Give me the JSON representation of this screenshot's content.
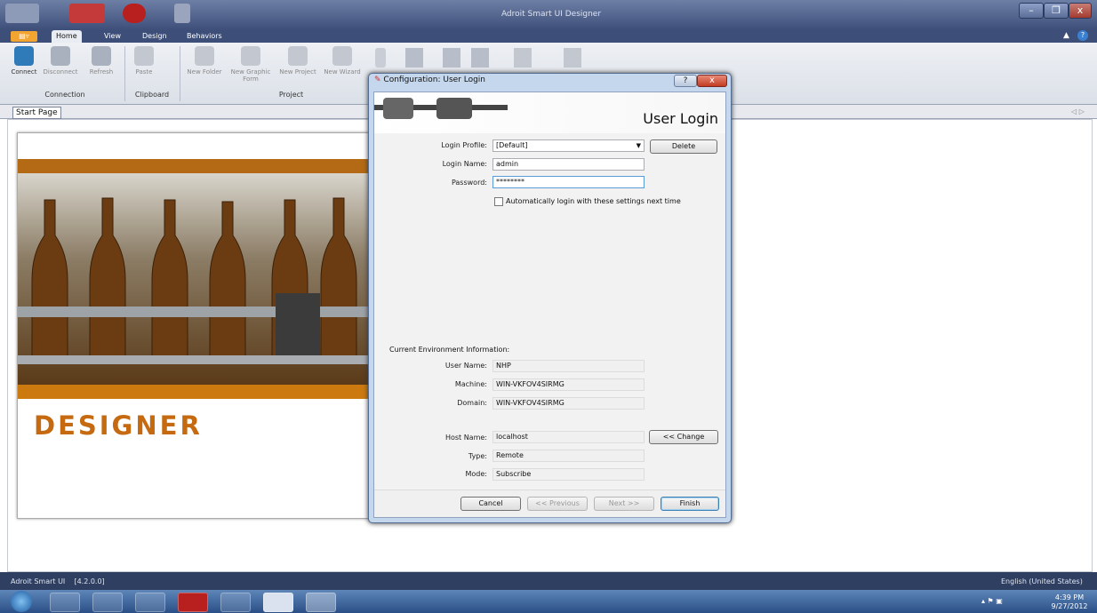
{
  "app": {
    "title": "Adroit Smart UI Designer",
    "tabs": [
      "Home",
      "View",
      "Design",
      "Behaviors"
    ],
    "window_controls": {
      "minimize": "–",
      "maximize": "❐",
      "close": "x"
    }
  },
  "ribbon": {
    "buttons": [
      {
        "label": "Connect",
        "icon": "connect-icon"
      },
      {
        "label": "Disconnect",
        "icon": "disconnect-icon"
      },
      {
        "label": "Refresh",
        "icon": "refresh-icon"
      },
      {
        "label": "Paste",
        "icon": "paste-icon"
      },
      {
        "label": "New Folder",
        "icon": "new-folder-icon"
      },
      {
        "label": "New Graphic Form",
        "icon": "new-graphic-form-icon"
      },
      {
        "label": "New Project",
        "icon": "new-project-icon"
      },
      {
        "label": "New Wizard",
        "icon": "new-wizard-icon"
      }
    ],
    "groups": [
      "Connection",
      "Clipboard",
      "Project"
    ]
  },
  "document_tab": "Start Page",
  "start_page": {
    "banner_text": "DESIGNER"
  },
  "dialog": {
    "title": "Configuration: User Login",
    "heading": "User Login",
    "login_profile_label": "Login Profile:",
    "login_profile_value": "[Default]",
    "delete_label": "Delete",
    "login_name_label": "Login Name:",
    "login_name_value": "admin",
    "password_label": "Password:",
    "password_value": "********",
    "auto_login_label": "Automatically login with these settings next time",
    "env_section_label": "Current Environment Information:",
    "user_name_label": "User Name:",
    "user_name_value": "NHP",
    "machine_label": "Machine:",
    "machine_value": "WIN-VKFOV4SIRMG",
    "domain_label": "Domain:",
    "domain_value": "WIN-VKFOV4SIRMG",
    "host_name_label": "Host Name:",
    "host_name_value": "localhost",
    "change_label": "<< Change",
    "type_label": "Type:",
    "type_value": "Remote",
    "mode_label": "Mode:",
    "mode_value": "Subscribe",
    "cancel_label": "Cancel",
    "previous_label": "<< Previous",
    "next_label": "Next >>",
    "finish_label": "Finish"
  },
  "statusbar": {
    "left": "Adroit Smart UI    [4.2.0.0]",
    "right": "English (United States)"
  },
  "taskbar": {
    "time": "4:39 PM",
    "date": "9/27/2012"
  }
}
